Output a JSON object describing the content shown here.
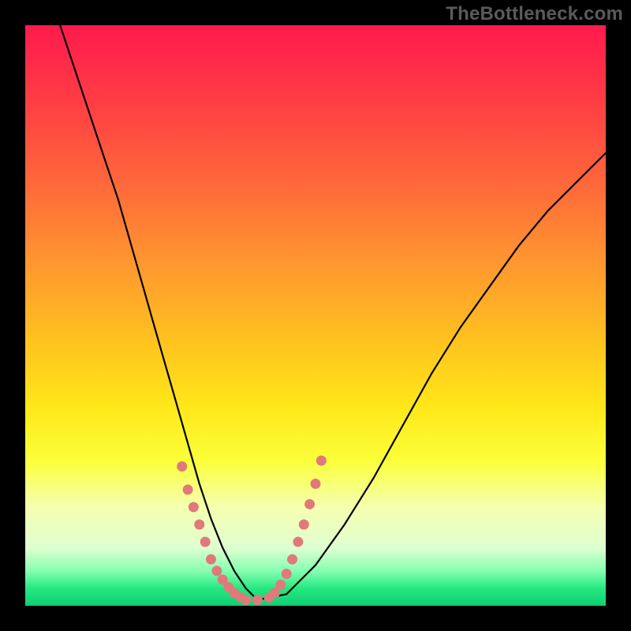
{
  "watermark": "TheBottleneck.com",
  "chart_data": {
    "type": "line",
    "title": "",
    "xlabel": "",
    "ylabel": "",
    "xlim": [
      0,
      100
    ],
    "ylim": [
      0,
      100
    ],
    "grid": false,
    "legend": false,
    "series": [
      {
        "name": "bottleneck-curve",
        "x": [
          6,
          8,
          10,
          12,
          14,
          16,
          18,
          20,
          22,
          24,
          26,
          28,
          30,
          32,
          34,
          36,
          38,
          40,
          45,
          50,
          55,
          60,
          65,
          70,
          75,
          80,
          85,
          90,
          95,
          100
        ],
        "y": [
          100,
          94,
          88,
          82,
          76,
          70,
          63,
          56,
          49,
          42,
          35,
          28,
          21,
          15,
          10,
          6,
          3,
          1,
          2,
          7,
          14,
          22,
          31,
          40,
          48,
          55,
          62,
          68,
          73,
          78
        ]
      }
    ],
    "markers": {
      "name": "highlighted-points",
      "color": "#e07a7a",
      "x": [
        27,
        28,
        29,
        30,
        31,
        32,
        33,
        34,
        35,
        36,
        37,
        38,
        40,
        42,
        43,
        44,
        45,
        46,
        47,
        48,
        49,
        50,
        51
      ],
      "y": [
        24,
        20,
        17,
        14,
        11,
        8,
        6,
        4.5,
        3.2,
        2.2,
        1.5,
        1,
        1,
        1.4,
        2.2,
        3.6,
        5.5,
        8,
        11,
        14,
        17.5,
        21,
        25
      ]
    },
    "background_gradient": {
      "top": "#ff1a4d",
      "bottom": "#0fd072"
    }
  }
}
